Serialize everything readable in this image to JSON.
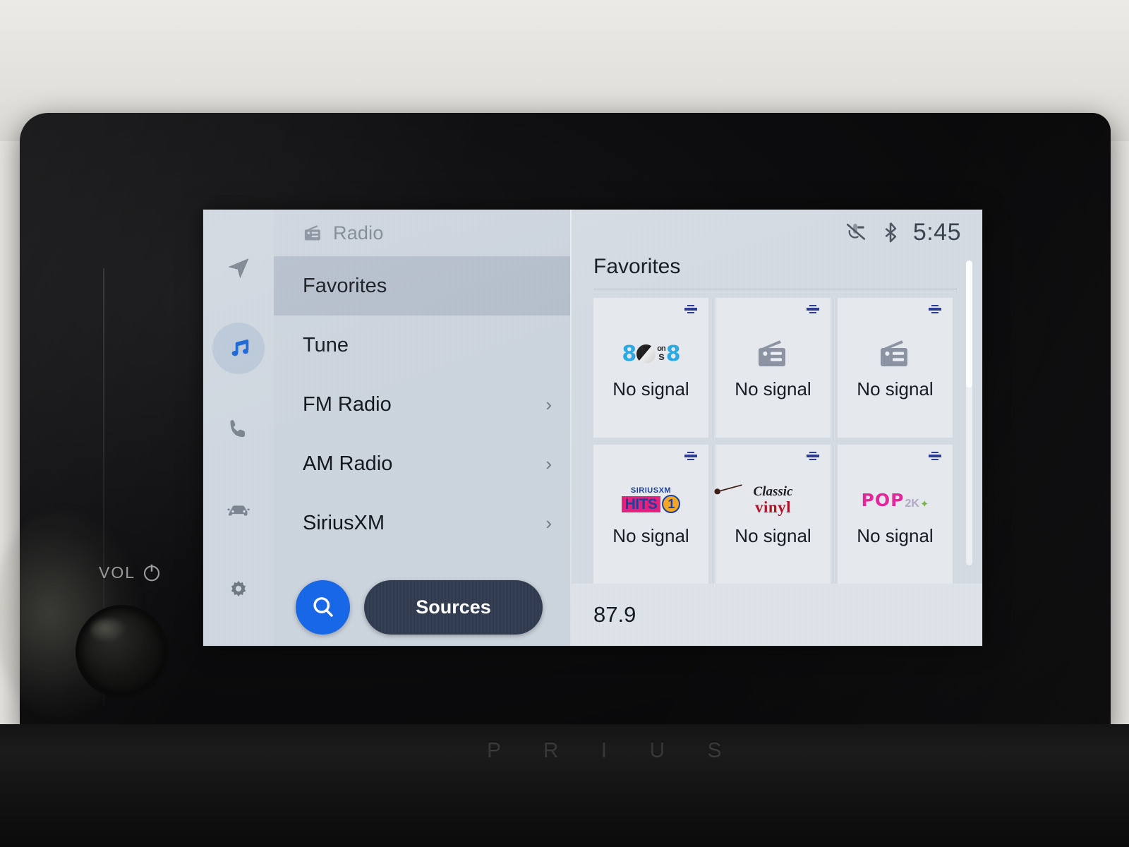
{
  "device": {
    "model_badge": "P R I U S",
    "volume_label": "VOL",
    "power_icon": "power-icon",
    "knob_name": "volume-knob"
  },
  "statusbar": {
    "mic_mute_icon": "microphone-mute-icon",
    "bluetooth_icon": "bluetooth-icon",
    "time": "5:45"
  },
  "rail": {
    "items": [
      {
        "icon": "navigation-arrow-icon",
        "name": "navigation",
        "active": false
      },
      {
        "icon": "music-note-icon",
        "name": "media",
        "active": true
      },
      {
        "icon": "phone-icon",
        "name": "phone",
        "active": false
      },
      {
        "icon": "car-icon",
        "name": "vehicle",
        "active": false
      },
      {
        "icon": "gear-icon",
        "name": "settings",
        "active": false
      }
    ]
  },
  "list_panel": {
    "header": {
      "icon": "radio-icon",
      "title": "Radio"
    },
    "items": [
      {
        "label": "Favorites",
        "selected": true,
        "chevron": ""
      },
      {
        "label": "Tune",
        "selected": false,
        "chevron": ""
      },
      {
        "label": "FM Radio",
        "selected": false,
        "chevron": "›"
      },
      {
        "label": "AM Radio",
        "selected": false,
        "chevron": "›"
      },
      {
        "label": "SiriusXM",
        "selected": false,
        "chevron": "›"
      }
    ],
    "search_button": {
      "icon": "search-icon",
      "label": ""
    },
    "sources_button": {
      "label": "Sources"
    }
  },
  "favorites_panel": {
    "title": "Favorites",
    "tiles": [
      {
        "logo": "80s-on-8-logo",
        "station": "80s on 8",
        "status": "No signal",
        "badge": "siriusxm-badge-icon"
      },
      {
        "logo": "generic-radio-logo",
        "station": "",
        "status": "No signal",
        "badge": "siriusxm-badge-icon"
      },
      {
        "logo": "generic-radio-logo",
        "station": "",
        "status": "No signal",
        "badge": "siriusxm-badge-icon"
      },
      {
        "logo": "siriusxm-hits-1-logo",
        "station": "SiriusXM Hits 1",
        "status": "No signal",
        "badge": "siriusxm-badge-icon"
      },
      {
        "logo": "classic-vinyl-logo",
        "station": "Classic Vinyl",
        "status": "No signal",
        "badge": "siriusxm-badge-icon"
      },
      {
        "logo": "pop2k-logo",
        "station": "Pop2K",
        "status": "No signal",
        "badge": "siriusxm-badge-icon"
      }
    ],
    "frequency": "87.9"
  },
  "colors": {
    "screen_bg": "#ced6df",
    "rail_bg": "#cfd7e0",
    "list_bg": "#ccd4de",
    "fav_bg": "#d4dbe3",
    "accent_blue": "#1566e8",
    "sources_dark": "#313b50",
    "selected_row": "#a0acbc",
    "text_primary": "#11151c",
    "text_muted": "#7c8694"
  }
}
